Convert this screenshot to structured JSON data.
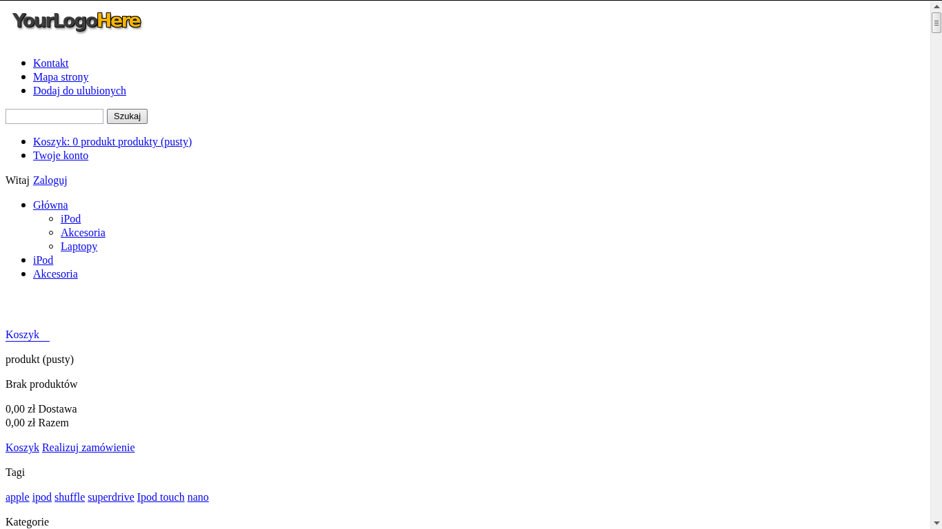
{
  "logo": {
    "parts": [
      "YourLogo",
      "Here"
    ]
  },
  "top_links": [
    "Kontakt",
    "Mapa strony",
    "Dodaj do ulubionych"
  ],
  "search": {
    "button": "Szukaj"
  },
  "user_links": [
    "Koszyk: 0 produkt produkty (pusty)",
    "Twoje konto"
  ],
  "greeting": {
    "text": "Witaj",
    "link": "Zaloguj"
  },
  "categories_menu": [
    {
      "label": "Główna",
      "children": [
        {
          "label": "iPod"
        },
        {
          "label": "Akcesoria"
        },
        {
          "label": "Laptopy"
        }
      ]
    },
    {
      "label": "iPod"
    },
    {
      "label": "Akcesoria"
    }
  ],
  "cart": {
    "title": "Koszyk",
    "count_text": "produkt (pusty)",
    "empty": "Brak produktów",
    "shipping": "0,00 zł Dostawa",
    "total": "0,00 zł Razem",
    "links": [
      "Koszyk",
      "Realizuj zamówienie"
    ]
  },
  "tags": {
    "title": "Tagi",
    "items": [
      "apple",
      "ipod",
      "shuffle",
      "superdrive",
      "Ipod touch",
      "nano"
    ]
  },
  "categories_title": "Kategorie"
}
